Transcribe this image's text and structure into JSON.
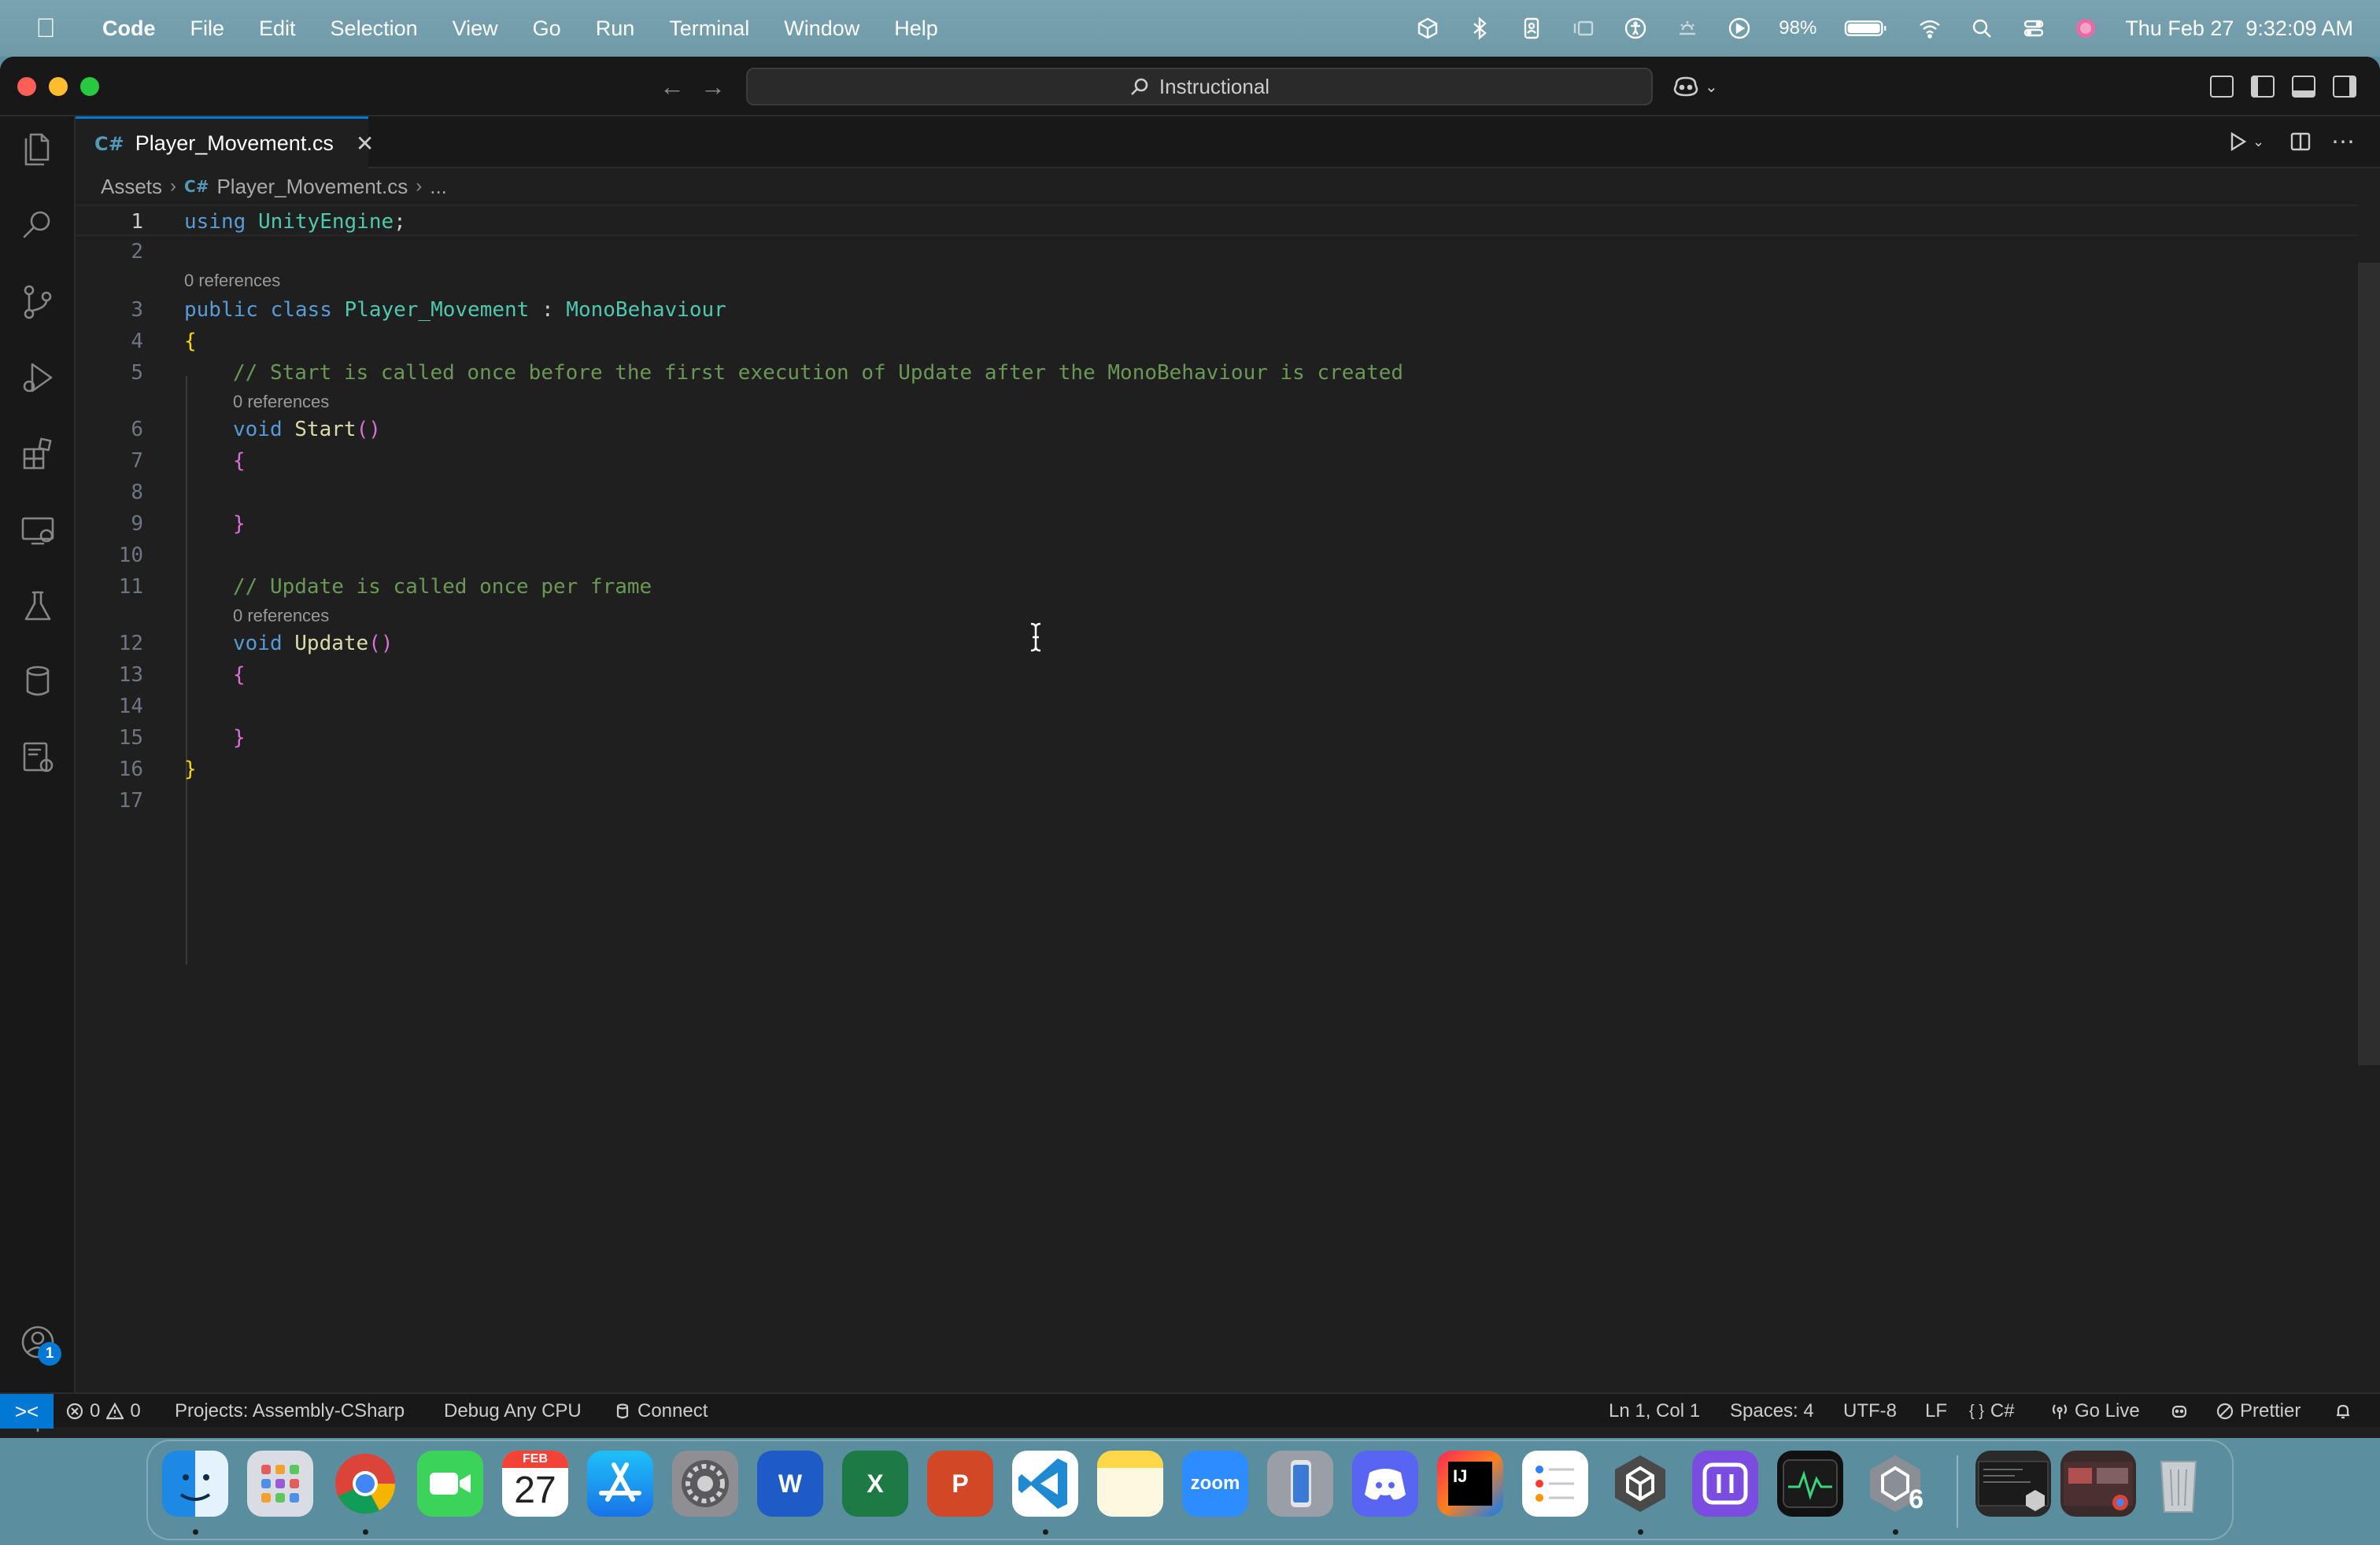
{
  "menubar": {
    "app": "Code",
    "items": [
      "File",
      "Edit",
      "Selection",
      "View",
      "Go",
      "Run",
      "Terminal",
      "Window",
      "Help"
    ],
    "battery": "98%",
    "datetime": "Thu Feb 27  9:32:09 AM"
  },
  "titlebar": {
    "search_text": "Instructional"
  },
  "tab": {
    "icon": "C#",
    "label": "Player_Movement.cs",
    "close": "✕"
  },
  "breadcrumb": {
    "folder": "Assets",
    "file": "Player_Movement.cs",
    "more": "..."
  },
  "editor": {
    "references_label": "0 references",
    "line_numbers": [
      "1",
      "2",
      "3",
      "4",
      "5",
      "6",
      "7",
      "8",
      "9",
      "10",
      "11",
      "12",
      "13",
      "14",
      "15",
      "16",
      "17"
    ],
    "tokens": {
      "using": "using",
      "unity_engine": "UnityEngine",
      "semicolon": ";",
      "public": "public",
      "class": "class",
      "class_name": "Player_Movement",
      "colon": " : ",
      "base_class": "MonoBehaviour",
      "open_brace": "{",
      "close_brace": "}",
      "comment_start": "// Start is called once before the first execution of Update after the MonoBehaviour is created",
      "void": "void",
      "start": "Start",
      "parens": "()",
      "comment_update": "// Update is called once per frame",
      "update": "Update"
    }
  },
  "statusbar": {
    "remote": "><",
    "errors": "0",
    "warnings": "0",
    "projects": "Projects: Assembly-CSharp",
    "debug": "Debug Any CPU",
    "connect": "Connect",
    "position": "Ln 1, Col 1",
    "spaces": "Spaces: 4",
    "encoding": "UTF-8",
    "eol": "LF",
    "language_braces": "{ }",
    "language": "C#",
    "golive": "Go Live",
    "prettier": "Prettier"
  },
  "dock": {
    "calendar_month": "FEB",
    "calendar_day": "27",
    "word": "W",
    "excel": "X",
    "powerpoint": "P",
    "zoom": "zoom",
    "intellij": "IJ",
    "unity_version": "6"
  },
  "badges": {
    "accounts": "1"
  },
  "colors": {
    "accent": "#0078d4",
    "editor_bg": "#1f1f1f",
    "keyword": "#569cd6",
    "type": "#4ec9b0",
    "function": "#dcdcaa",
    "comment": "#6a9955"
  }
}
